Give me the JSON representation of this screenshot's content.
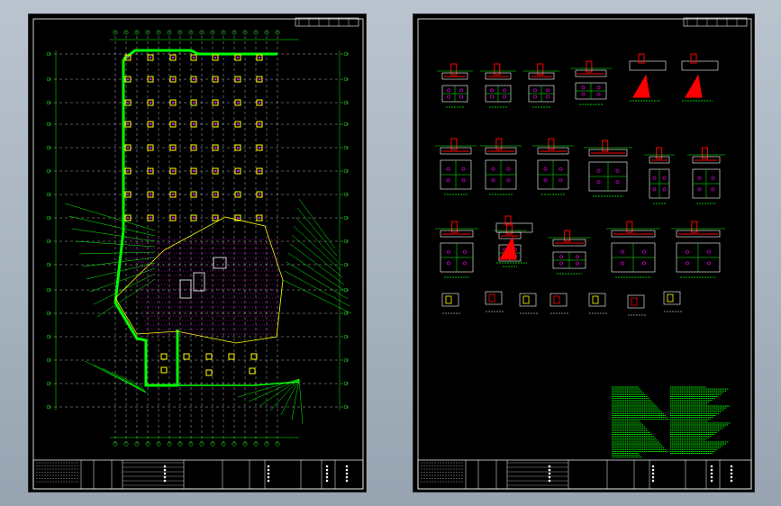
{
  "colors": {
    "background": "#a9b5c1",
    "sheet": "#000000",
    "frame": "#ffffff",
    "axis": "#00ff00",
    "column": "#ffff00",
    "pile": "#ff00ff",
    "grid": "#ffffff",
    "rebar": "#ff0000",
    "wall": "#00ff00"
  },
  "sheets": [
    {
      "id": "plan",
      "icon": "foundation-plan-drawing"
    },
    {
      "id": "details",
      "icon": "pile-cap-detail-drawing"
    }
  ]
}
